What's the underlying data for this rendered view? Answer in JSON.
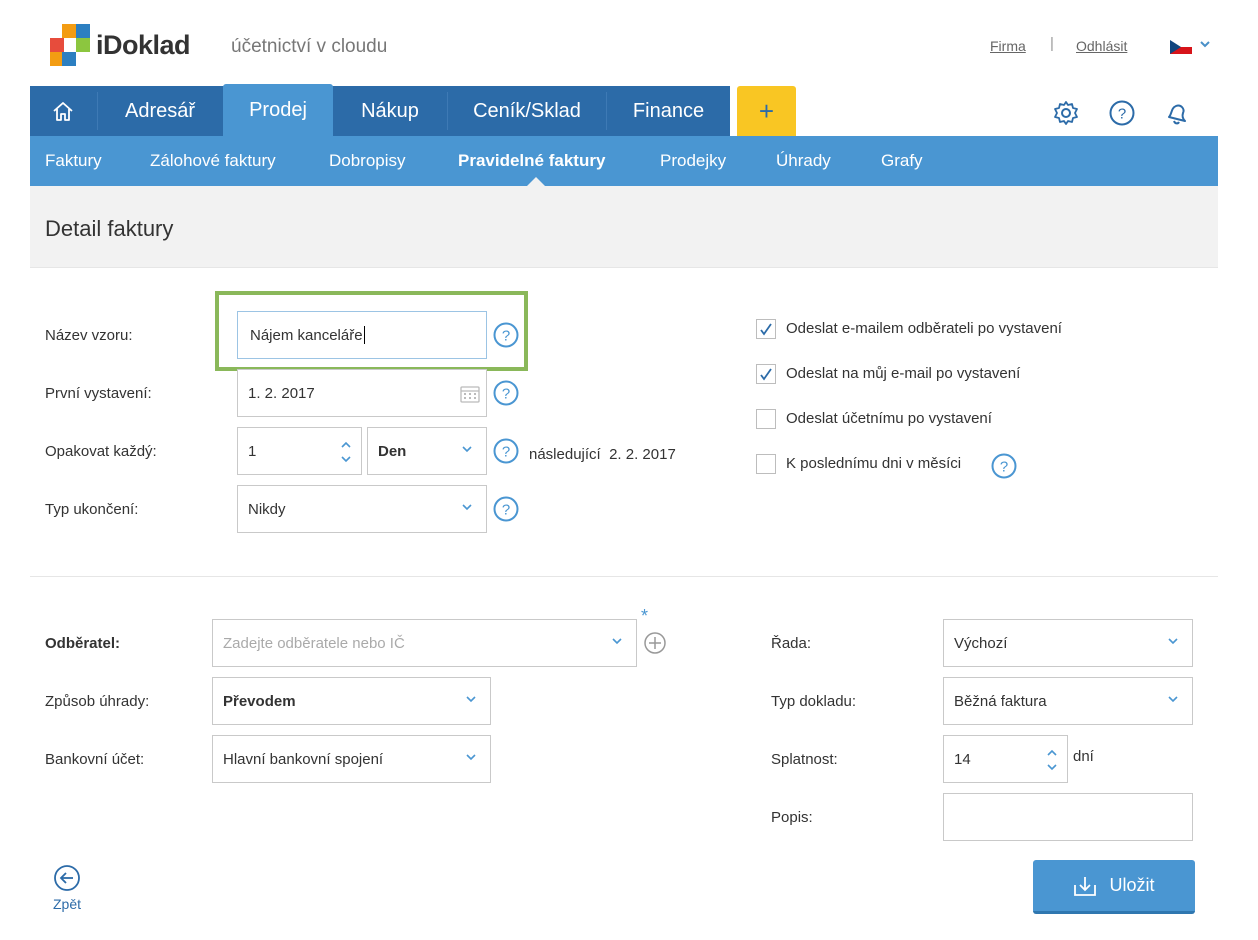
{
  "header": {
    "logo_text": "iDoklad",
    "tagline": "účetnictví v cloudu",
    "link_company": "Firma",
    "link_separator": "|",
    "link_logout": "Odhlásit"
  },
  "main_nav": {
    "items": [
      {
        "label": "Adresář"
      },
      {
        "label": "Prodej"
      },
      {
        "label": "Nákup"
      },
      {
        "label": "Ceník/Sklad"
      },
      {
        "label": "Finance"
      }
    ],
    "plus_label": "+"
  },
  "sub_nav": {
    "items": [
      {
        "label": "Faktury"
      },
      {
        "label": "Zálohové faktury"
      },
      {
        "label": "Dobropisy"
      },
      {
        "label": "Pravidelné faktury"
      },
      {
        "label": "Prodejky"
      },
      {
        "label": "Úhrady"
      },
      {
        "label": "Grafy"
      }
    ]
  },
  "page_title": "Detail faktury",
  "template": {
    "name_label": "Název vzoru:",
    "name_value": "Nájem kanceláře",
    "first_issue_label": "První vystavení:",
    "first_issue_value": "1. 2. 2017",
    "repeat_label": "Opakovat každý:",
    "repeat_value": "1",
    "repeat_unit": "Den",
    "next_label": "následující",
    "next_date": "2. 2. 2017",
    "end_type_label": "Typ ukončení:",
    "end_type_value": "Nikdy"
  },
  "options": [
    {
      "label": "Odeslat e-mailem odběrateli po vystavení",
      "checked": true
    },
    {
      "label": "Odeslat na můj e-mail po vystavení",
      "checked": true
    },
    {
      "label": "Odeslat účetnímu po vystavení",
      "checked": false
    },
    {
      "label": "K poslednímu dni v měsíci",
      "checked": false
    }
  ],
  "invoice": {
    "customer_label": "Odběratel:",
    "customer_placeholder": "Zadejte odběratele nebo IČ",
    "required_mark": "*",
    "payment_label": "Způsob úhrady:",
    "payment_value": "Převodem",
    "bank_label": "Bankovní účet:",
    "bank_value": "Hlavní bankovní spojení",
    "series_label": "Řada:",
    "series_value": "Výchozí",
    "doc_type_label": "Typ dokladu:",
    "doc_type_value": "Běžná faktura",
    "due_label": "Splatnost:",
    "due_value": "14",
    "due_unit": "dní",
    "desc_label": "Popis:",
    "desc_value": ""
  },
  "actions": {
    "save_label": "Uložit",
    "back_label": "Zpět"
  },
  "colors": {
    "nav_dark": "#2c6ba8",
    "nav_light": "#4a96d2",
    "accent_yellow": "#f9c623",
    "highlight_green": "#8ab85a"
  }
}
